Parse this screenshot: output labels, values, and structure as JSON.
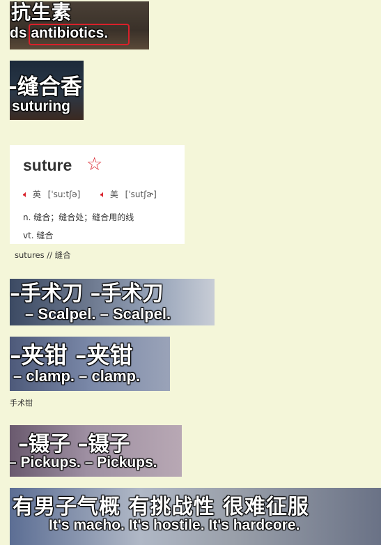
{
  "clips": [
    {
      "cn": "抗生素",
      "en": "ds antibiotics."
    },
    {
      "cn": "-缝合香",
      "en": "suturing"
    },
    {
      "cn": "–手术刀  –手术刀",
      "en": "– Scalpel. – Scalpel."
    },
    {
      "cn": "–夹钳  –夹钳",
      "en": "– clamp. – clamp."
    },
    {
      "cn": "–镊子  –镊子",
      "en": "– Pickups. – Pickups."
    },
    {
      "cn": "有男子气概  有挑战性  很难征服",
      "en": "It's macho. It's hostile. It's hardcore."
    }
  ],
  "dictionary": {
    "word": "suture",
    "star": "☆",
    "uk_label": "英",
    "uk_ipa": "[ˈsuːtʃə]",
    "us_label": "美",
    "us_ipa": "[ˈsutʃɚ]",
    "speaker_icon": "speaker-icon",
    "def_n": "n. 缝合；缝合处；缝合用的线",
    "def_vt": "vt. 缝合"
  },
  "notes": {
    "sutures": "sutures  // 缝合",
    "forceps": "手术钳"
  },
  "colors": {
    "background": "#f4f6d9",
    "highlight": "#d9202a"
  }
}
